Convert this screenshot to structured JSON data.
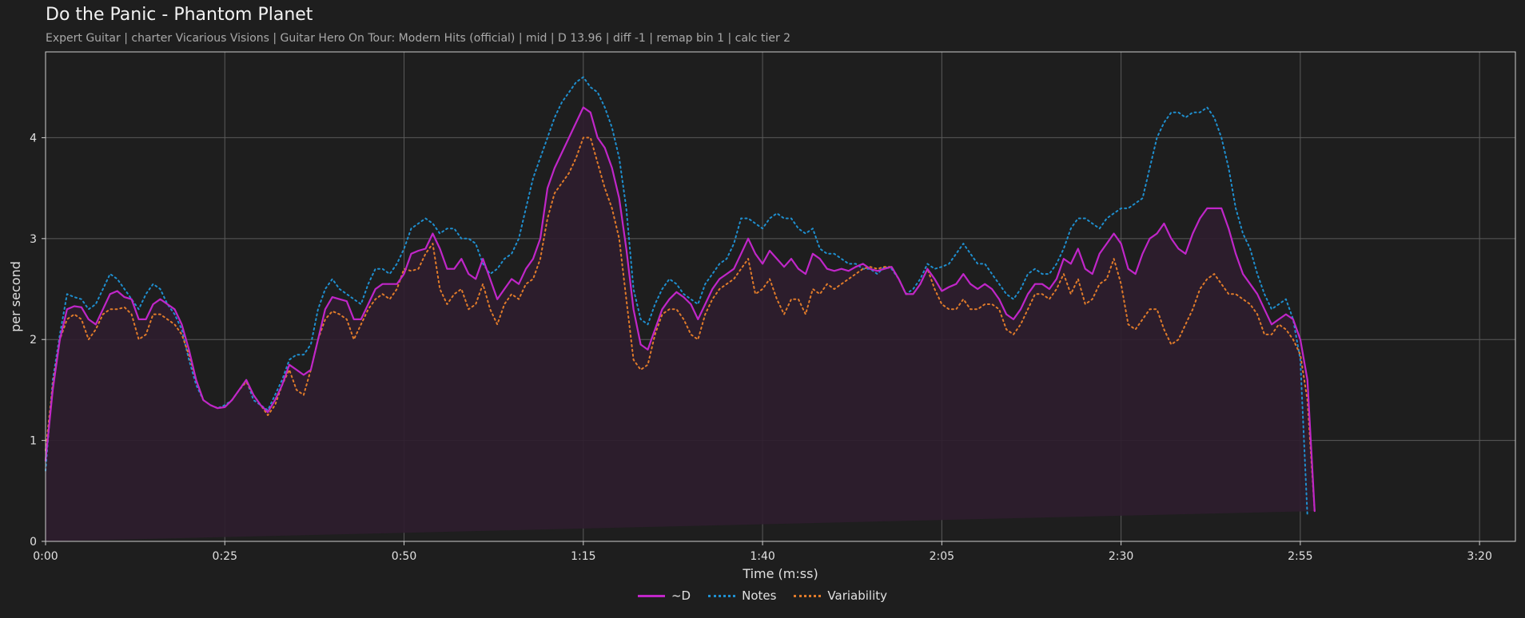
{
  "title": "Do the Panic - Phantom Planet",
  "subtitle": "Expert Guitar  |  charter Vicarious Visions  |  Guitar Hero On Tour: Modern Hits (official)  |  mid  |  D 13.96  |  diff -1  |  remap bin 1  |  calc tier 2",
  "colors": {
    "background": "#1e1e1e",
    "d": "#c026c8",
    "notes": "#1f8fcf",
    "variability": "#e07b2a",
    "fill": "#2e1d2e",
    "grid": "#5a5a5a"
  },
  "chart_data": {
    "type": "line",
    "xlabel": "Time (m:ss)",
    "ylabel": "per second",
    "xlim": [
      0,
      205
    ],
    "ylim": [
      0,
      4.85
    ],
    "xticks": [
      0,
      25,
      50,
      75,
      100,
      125,
      150,
      175,
      200
    ],
    "xtick_labels": [
      "0:00",
      "0:25",
      "0:50",
      "1:15",
      "1:40",
      "2:05",
      "2:30",
      "2:55",
      "3:20"
    ],
    "yticks": [
      0,
      1,
      2,
      3,
      4
    ],
    "ytick_labels": [
      "0",
      "1",
      "2",
      "3",
      "4"
    ],
    "grid": true,
    "legend_position": "bottom-center",
    "x": [
      0,
      1,
      2,
      3,
      4,
      5,
      6,
      7,
      8,
      9,
      10,
      11,
      12,
      13,
      14,
      15,
      16,
      17,
      18,
      19,
      20,
      21,
      22,
      23,
      24,
      25,
      26,
      27,
      28,
      29,
      30,
      31,
      32,
      33,
      34,
      35,
      36,
      37,
      38,
      39,
      40,
      41,
      42,
      43,
      44,
      45,
      46,
      47,
      48,
      49,
      50,
      51,
      52,
      53,
      54,
      55,
      56,
      57,
      58,
      59,
      60,
      61,
      62,
      63,
      64,
      65,
      66,
      67,
      68,
      69,
      70,
      71,
      72,
      73,
      74,
      75,
      76,
      77,
      78,
      79,
      80,
      81,
      82,
      83,
      84,
      85,
      86,
      87,
      88,
      89,
      90,
      91,
      92,
      93,
      94,
      95,
      96,
      97,
      98,
      99,
      100,
      101,
      102,
      103,
      104,
      105,
      106,
      107,
      108,
      109,
      110,
      111,
      112,
      113,
      114,
      115,
      116,
      117,
      118,
      119,
      120,
      121,
      122,
      123,
      124,
      125,
      126,
      127,
      128,
      129,
      130,
      131,
      132,
      133,
      134,
      135,
      136,
      137,
      138,
      139,
      140,
      141,
      142,
      143,
      144,
      145,
      146,
      147,
      148,
      149,
      150,
      151,
      152,
      153,
      154,
      155,
      156,
      157,
      158,
      159,
      160,
      161,
      162,
      163,
      164,
      165,
      166,
      167,
      168,
      169,
      170,
      171,
      172,
      173,
      174,
      175,
      176,
      177,
      178,
      179,
      180,
      181,
      182,
      183,
      184,
      185,
      186,
      187,
      188,
      189,
      190,
      191,
      192,
      193,
      194,
      195,
      196,
      197,
      198,
      199,
      200,
      201,
      202,
      203,
      204,
      205
    ],
    "series": [
      {
        "name": "~D",
        "style": "solid",
        "values": [
          0.8,
          1.5,
          2.0,
          2.3,
          2.33,
          2.32,
          2.2,
          2.15,
          2.3,
          2.45,
          2.48,
          2.42,
          2.4,
          2.2,
          2.2,
          2.35,
          2.4,
          2.35,
          2.3,
          2.15,
          1.9,
          1.6,
          1.4,
          1.35,
          1.32,
          1.33,
          1.4,
          1.5,
          1.6,
          1.45,
          1.35,
          1.28,
          1.4,
          1.55,
          1.75,
          1.7,
          1.65,
          1.7,
          2.0,
          2.3,
          2.42,
          2.4,
          2.38,
          2.2,
          2.2,
          2.35,
          2.5,
          2.55,
          2.55,
          2.55,
          2.65,
          2.85,
          2.88,
          2.9,
          3.05,
          2.9,
          2.7,
          2.7,
          2.8,
          2.65,
          2.6,
          2.8,
          2.6,
          2.4,
          2.5,
          2.6,
          2.55,
          2.7,
          2.8,
          3.0,
          3.5,
          3.7,
          3.85,
          4.0,
          4.15,
          4.3,
          4.25,
          4.0,
          3.9,
          3.7,
          3.4,
          2.9,
          2.3,
          1.95,
          1.9,
          2.1,
          2.3,
          2.4,
          2.47,
          2.42,
          2.35,
          2.2,
          2.35,
          2.5,
          2.6,
          2.65,
          2.7,
          2.85,
          3.0,
          2.85,
          2.75,
          2.88,
          2.8,
          2.72,
          2.8,
          2.7,
          2.65,
          2.85,
          2.8,
          2.7,
          2.68,
          2.7,
          2.68,
          2.72,
          2.75,
          2.7,
          2.68,
          2.7,
          2.72,
          2.6,
          2.45,
          2.45,
          2.55,
          2.7,
          2.6,
          2.48,
          2.52,
          2.55,
          2.65,
          2.55,
          2.5,
          2.55,
          2.5,
          2.4,
          2.25,
          2.2,
          2.3,
          2.45,
          2.55,
          2.55,
          2.5,
          2.6,
          2.8,
          2.75,
          2.9,
          2.7,
          2.65,
          2.85,
          2.95,
          3.05,
          2.95,
          2.7,
          2.65,
          2.85,
          3.0,
          3.05,
          3.15,
          3.0,
          2.9,
          2.85,
          3.05,
          3.2,
          3.3,
          3.3,
          3.3,
          3.1,
          2.85,
          2.65,
          2.55,
          2.45,
          2.3,
          2.15,
          2.2,
          2.25,
          2.2,
          2.0,
          1.6,
          0.3
        ]
      },
      {
        "name": "Notes",
        "style": "dotted",
        "values": [
          0.7,
          1.6,
          2.05,
          2.45,
          2.42,
          2.4,
          2.3,
          2.35,
          2.5,
          2.65,
          2.6,
          2.5,
          2.4,
          2.3,
          2.45,
          2.55,
          2.5,
          2.35,
          2.25,
          2.1,
          1.8,
          1.55,
          1.4,
          1.35,
          1.32,
          1.35,
          1.4,
          1.5,
          1.6,
          1.4,
          1.35,
          1.3,
          1.45,
          1.6,
          1.8,
          1.85,
          1.85,
          1.95,
          2.3,
          2.5,
          2.6,
          2.5,
          2.45,
          2.4,
          2.35,
          2.55,
          2.7,
          2.7,
          2.65,
          2.75,
          2.9,
          3.1,
          3.15,
          3.2,
          3.15,
          3.05,
          3.1,
          3.1,
          3.0,
          3.0,
          2.95,
          2.75,
          2.65,
          2.7,
          2.8,
          2.85,
          3.0,
          3.3,
          3.6,
          3.8,
          4.0,
          4.2,
          4.35,
          4.45,
          4.55,
          4.6,
          4.5,
          4.45,
          4.3,
          4.1,
          3.8,
          3.3,
          2.5,
          2.2,
          2.15,
          2.35,
          2.5,
          2.6,
          2.55,
          2.45,
          2.4,
          2.35,
          2.55,
          2.65,
          2.75,
          2.8,
          2.95,
          3.2,
          3.2,
          3.15,
          3.1,
          3.2,
          3.25,
          3.2,
          3.2,
          3.1,
          3.05,
          3.1,
          2.9,
          2.85,
          2.85,
          2.8,
          2.75,
          2.75,
          2.7,
          2.7,
          2.65,
          2.72,
          2.7,
          2.6,
          2.45,
          2.5,
          2.6,
          2.75,
          2.7,
          2.72,
          2.75,
          2.85,
          2.95,
          2.85,
          2.75,
          2.75,
          2.65,
          2.55,
          2.45,
          2.4,
          2.5,
          2.65,
          2.7,
          2.65,
          2.65,
          2.75,
          2.9,
          3.1,
          3.2,
          3.2,
          3.15,
          3.1,
          3.2,
          3.25,
          3.3,
          3.3,
          3.35,
          3.4,
          3.7,
          4.0,
          4.15,
          4.25,
          4.25,
          4.2,
          4.25,
          4.25,
          4.3,
          4.2,
          4.0,
          3.7,
          3.3,
          3.05,
          2.9,
          2.65,
          2.45,
          2.3,
          2.35,
          2.4,
          2.2,
          1.8,
          0.25
        ]
      },
      {
        "name": "Variability",
        "style": "dotted",
        "values": [
          0.9,
          1.55,
          2.0,
          2.2,
          2.25,
          2.2,
          2.0,
          2.1,
          2.25,
          2.3,
          2.3,
          2.32,
          2.25,
          2.0,
          2.05,
          2.25,
          2.25,
          2.2,
          2.15,
          2.05,
          1.85,
          1.6,
          1.4,
          1.35,
          1.32,
          1.33,
          1.4,
          1.5,
          1.58,
          1.45,
          1.35,
          1.25,
          1.35,
          1.55,
          1.7,
          1.5,
          1.45,
          1.7,
          2.0,
          2.2,
          2.28,
          2.25,
          2.2,
          2.0,
          2.15,
          2.3,
          2.4,
          2.45,
          2.4,
          2.5,
          2.7,
          2.68,
          2.7,
          2.85,
          2.95,
          2.5,
          2.35,
          2.45,
          2.5,
          2.3,
          2.35,
          2.55,
          2.3,
          2.15,
          2.35,
          2.45,
          2.4,
          2.55,
          2.6,
          2.8,
          3.2,
          3.45,
          3.55,
          3.65,
          3.8,
          4.0,
          4.0,
          3.75,
          3.5,
          3.3,
          3.0,
          2.4,
          1.8,
          1.7,
          1.75,
          2.05,
          2.25,
          2.3,
          2.3,
          2.2,
          2.05,
          2.0,
          2.25,
          2.4,
          2.5,
          2.55,
          2.6,
          2.7,
          2.8,
          2.45,
          2.5,
          2.6,
          2.4,
          2.25,
          2.4,
          2.4,
          2.25,
          2.5,
          2.45,
          2.55,
          2.5,
          2.55,
          2.6,
          2.65,
          2.7,
          2.72,
          2.7,
          2.72,
          2.72,
          2.6,
          2.45,
          2.45,
          2.55,
          2.7,
          2.5,
          2.35,
          2.3,
          2.3,
          2.4,
          2.3,
          2.3,
          2.35,
          2.35,
          2.3,
          2.1,
          2.05,
          2.15,
          2.3,
          2.45,
          2.45,
          2.4,
          2.5,
          2.65,
          2.45,
          2.6,
          2.35,
          2.4,
          2.55,
          2.6,
          2.8,
          2.55,
          2.15,
          2.1,
          2.2,
          2.3,
          2.3,
          2.1,
          1.95,
          2.0,
          2.15,
          2.3,
          2.5,
          2.6,
          2.65,
          2.55,
          2.45,
          2.45,
          2.4,
          2.35,
          2.25,
          2.05,
          2.05,
          2.15,
          2.1,
          2.0,
          1.85,
          1.4,
          0.3
        ]
      }
    ]
  }
}
